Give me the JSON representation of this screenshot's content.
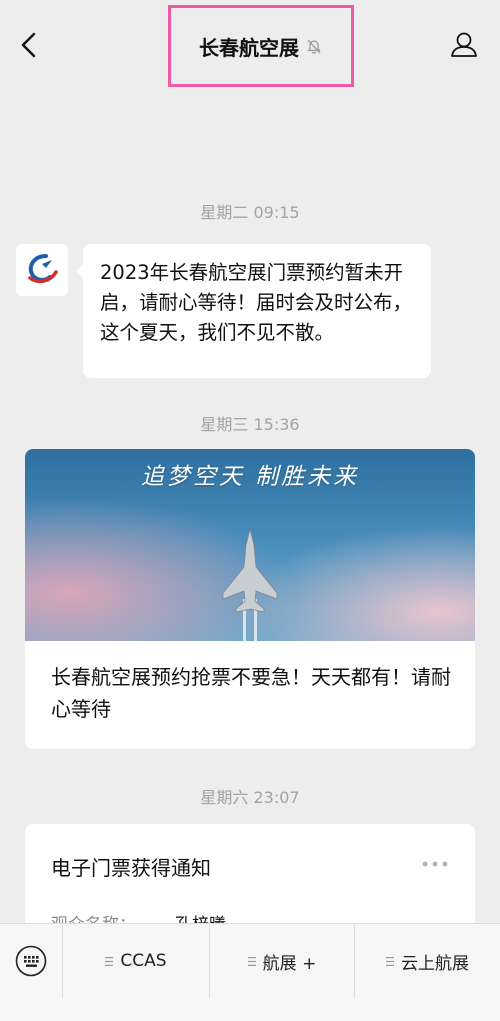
{
  "header": {
    "title": "长春航空展",
    "back_icon": "chevron-left-icon",
    "mute_icon": "bell-slash-icon",
    "profile_icon": "person-icon",
    "highlight_color": "#ef5aa7"
  },
  "messages": [
    {
      "time": "星期二 09:15",
      "text": "2023年长春航空展门票预约暂未开启，请耐心等待！届时会及时公布，这个夏天，我们不见不散。"
    },
    {
      "time": "星期三 15:36",
      "article": {
        "image_caption": "追梦空天 制胜未来",
        "title": "长春航空展预约抢票不要急！天天都有！请耐心等待"
      }
    },
    {
      "time": "星期六 23:07",
      "notice": {
        "title": "电子门票获得通知",
        "row_label": "观众名称：",
        "row_value": "孔梓曦"
      }
    }
  ],
  "bottom_menu": {
    "keyboard_icon": "keyboard-icon",
    "items": [
      {
        "label": "CCAS"
      },
      {
        "label": "航展 +"
      },
      {
        "label": "云上航展"
      }
    ]
  }
}
